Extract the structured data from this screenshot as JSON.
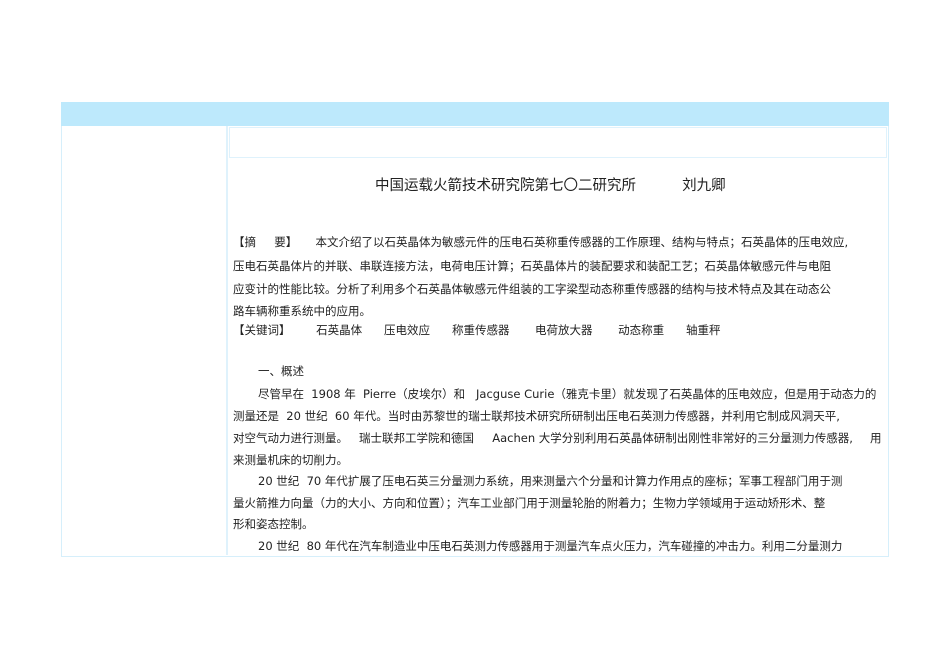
{
  "title": "中国运载火箭技术研究院第七〇二研究所          刘九卿",
  "abstract_lines": [
    "【摘     要】     本文介绍了以石英晶体为敏感元件的压电石英称重传感器的工作原理、结构与特点；石英晶体的压电效应,",
    "压电石英晶体片的并联、串联连接方法，电荷电压计算；石英晶体片的装配要求和装配工艺；石英晶体敏感元件与电阻",
    "应变计的性能比较。分析了利用多个石英晶体敏感元件组装的工字梁型动态称重传感器的结构与技术特点及其在动态公",
    "路车辆称重系统中的应用。",
    "【关键词】       石英晶体      压电效应      称重传感器       电荷放大器       动态称重      轴重秤"
  ],
  "section_heading": "一、概述",
  "body_lines": [
    "尽管早在  1908 年  Pierre（皮埃尔）和   Jacguse Curie（雅克卡里）就发现了石英晶体的压电效应，但是用于动态力的",
    "测量还是  20 世纪  60 年代。当时由苏黎世的瑞士联邦技术研究所研制出压电石英测力传感器，并利用它制成风洞天平,",
    "对空气动力进行测量。   瑞士联邦工学院和德国     Aachen 大学分别利用石英晶体研制出刚性非常好的三分量测力传感器,",
    "来测量机床的切削力。",
    "20 世纪  70 年代扩展了压电石英三分量测力系统，用来测量六个分量和计算力作用点的座标；军事工程部门用于测",
    "量火箭推力向量（力的大小、方向和位置）；汽车工业部门用于测量轮胎的附着力；生物力学领域用于运动矫形术、整",
    "形和姿态控制。",
    "20 世纪  80 年代在汽车制造业中压电石英测力传感器用于测量汽车点火压力，汽车碰撞的冲击力。利用二分量测力"
  ],
  "trailing_word": "用"
}
